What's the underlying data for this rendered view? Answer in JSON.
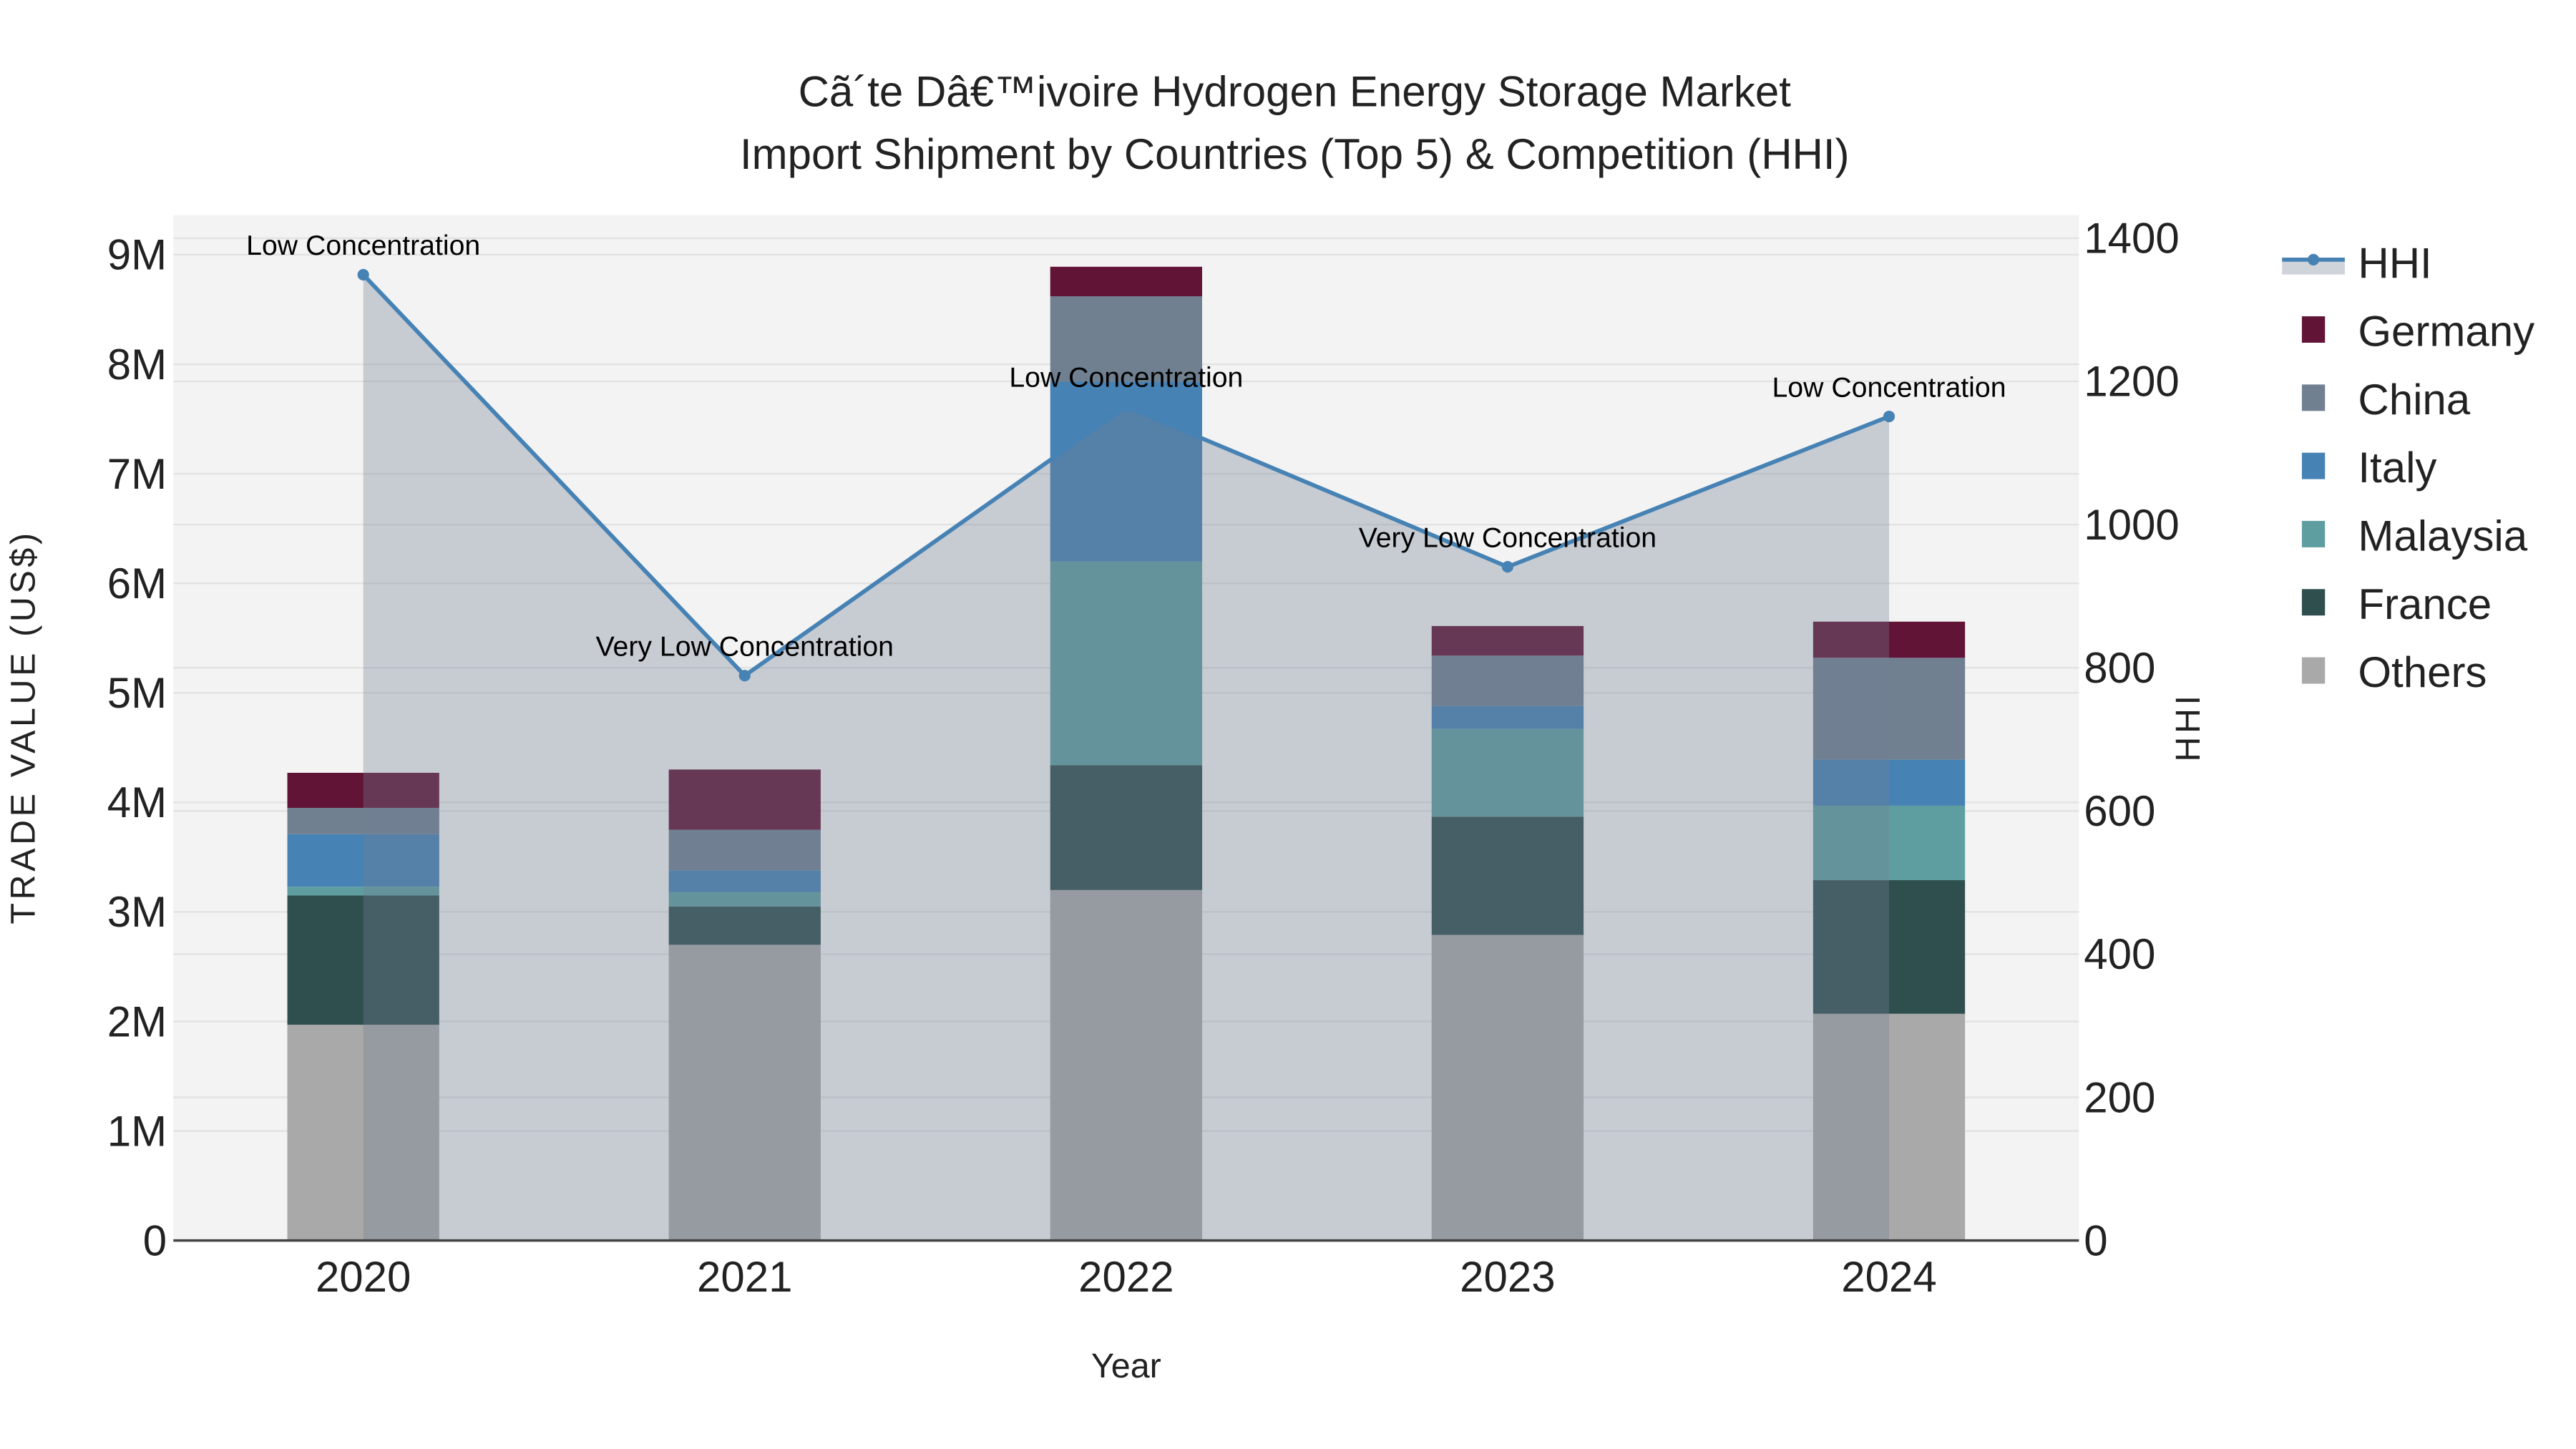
{
  "chart_data": {
    "type": "bar",
    "stacked": true,
    "title": "Cã´te Dâ€™ivoire Hydrogen Energy Storage Market",
    "subtitle": "Import Shipment by Countries (Top 5) & Competition (HHI)",
    "xlabel": "Year",
    "ylabel": "TRADE VALUE (US$)",
    "y2label": "HHI",
    "categories": [
      "2020",
      "2021",
      "2022",
      "2023",
      "2024"
    ],
    "ylim": [
      0,
      9300000
    ],
    "yticks": [
      0,
      1000000,
      2000000,
      3000000,
      4000000,
      5000000,
      6000000,
      7000000,
      8000000,
      9000000
    ],
    "ytick_labels": [
      "0",
      "1M",
      "2M",
      "3M",
      "4M",
      "5M",
      "6M",
      "7M",
      "8M",
      "9M"
    ],
    "y2lim": [
      0,
      1430
    ],
    "y2ticks": [
      0,
      200,
      400,
      600,
      800,
      1000,
      1200,
      1400
    ],
    "y2tick_labels": [
      "0",
      "200",
      "400",
      "600",
      "800",
      "1000",
      "1200",
      "1400"
    ],
    "grid": true,
    "legend_position": "right",
    "series": [
      {
        "name": "Others",
        "color": "#a9a9a9",
        "values": [
          1970000,
          2700000,
          3200000,
          2790000,
          2070000
        ]
      },
      {
        "name": "France",
        "color": "#2f4f4f",
        "values": [
          1180000,
          350000,
          1140000,
          1080000,
          1220000
        ]
      },
      {
        "name": "Malaysia",
        "color": "#5f9ea0",
        "values": [
          80000,
          130000,
          1860000,
          800000,
          680000
        ]
      },
      {
        "name": "Italy",
        "color": "#4682b4",
        "values": [
          480000,
          200000,
          1640000,
          210000,
          420000
        ]
      },
      {
        "name": "China",
        "color": "#708090",
        "values": [
          240000,
          370000,
          780000,
          460000,
          930000
        ]
      },
      {
        "name": "Germany",
        "color": "#611436",
        "values": [
          320000,
          550000,
          270000,
          270000,
          330000
        ]
      }
    ],
    "line_series": {
      "name": "HHI",
      "axis": "right",
      "color": "#4682b4",
      "fill": "tozeroy",
      "values": [
        1349,
        789,
        1165,
        941,
        1151
      ],
      "annotations": [
        "Low Concentration",
        "Very Low Concentration",
        "Low Concentration",
        "Very Low Concentration",
        "Low Concentration"
      ]
    },
    "legend_order": [
      "HHI",
      "Germany",
      "China",
      "Italy",
      "Malaysia",
      "France",
      "Others"
    ]
  }
}
